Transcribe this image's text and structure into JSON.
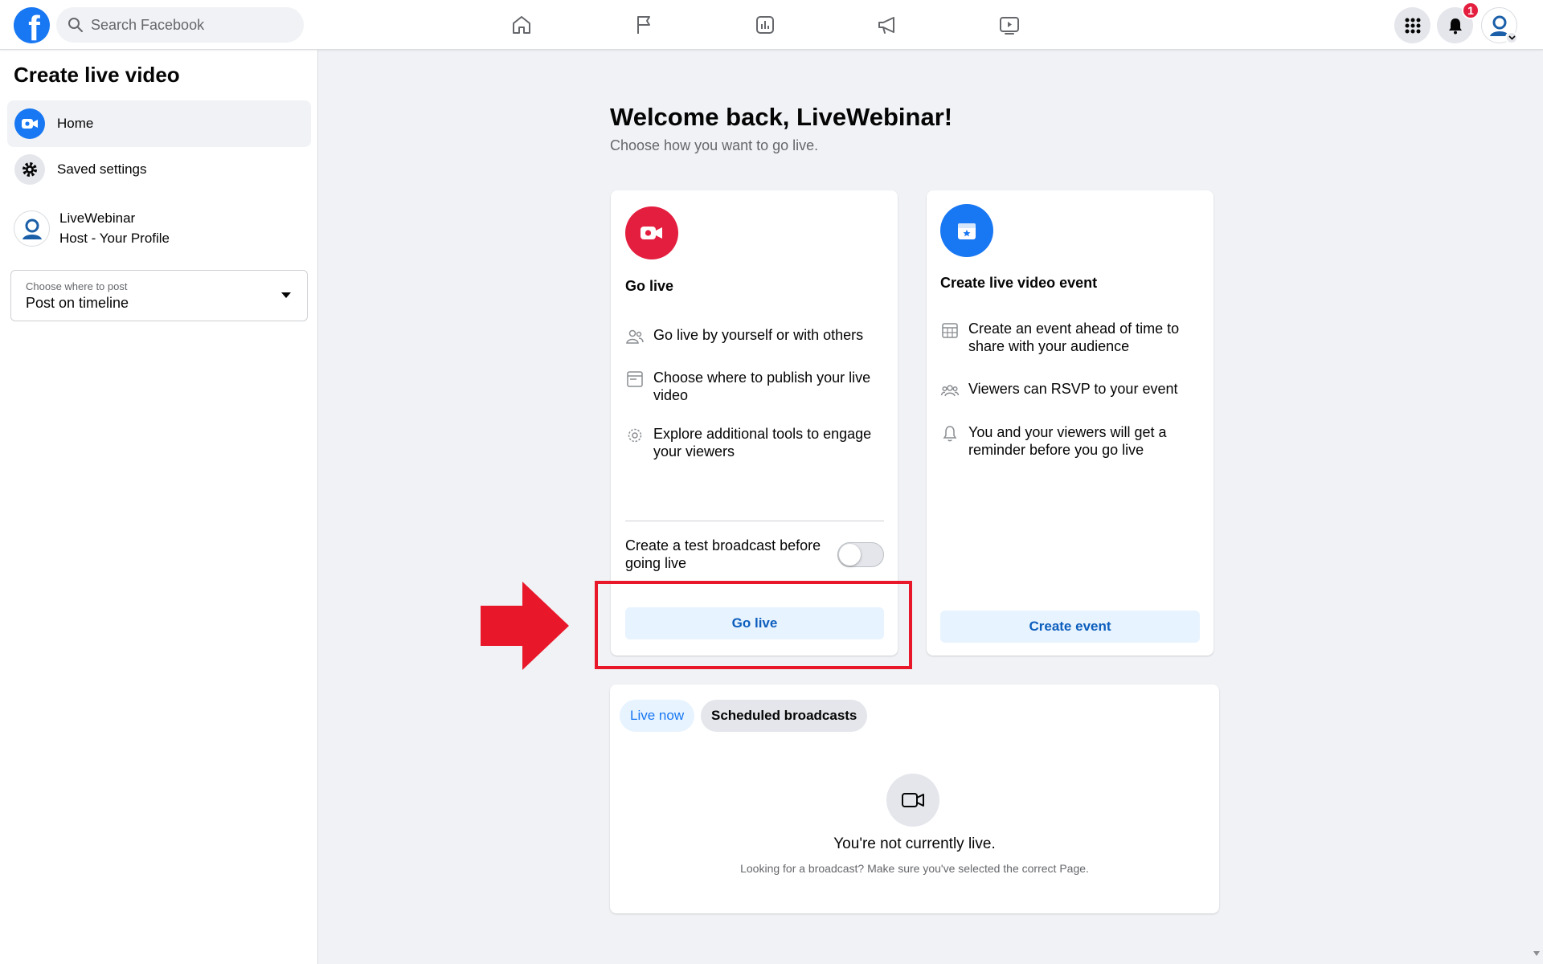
{
  "topbar": {
    "logo_letter": "f",
    "search_placeholder": "Search Facebook",
    "nav_icons": [
      "home-icon",
      "flag-icon",
      "insights-icon",
      "megaphone-icon",
      "video-icon"
    ],
    "notification_count": "1"
  },
  "sidebar": {
    "title": "Create live video",
    "items": [
      {
        "label": "Home",
        "icon": "live-video-icon",
        "active": true
      },
      {
        "label": "Saved settings",
        "icon": "gear-icon",
        "active": false
      }
    ],
    "profile": {
      "name": "LiveWebinar",
      "subtitle": "Host - Your Profile"
    },
    "post_select": {
      "label": "Choose where to post",
      "value": "Post on timeline"
    }
  },
  "main": {
    "welcome": "Welcome back, LiveWebinar!",
    "subtitle": "Choose how you want to go live.",
    "go_live_card": {
      "title": "Go live",
      "features": [
        "Go live by yourself or with others",
        "Choose where to publish your live video",
        "Explore additional tools to engage your viewers"
      ],
      "toggle_label": "Create a test broadcast before going live",
      "toggle_on": false,
      "button": "Go live"
    },
    "event_card": {
      "title": "Create live video event",
      "features": [
        "Create an event ahead of time to share with your audience",
        "Viewers can RSVP to your event",
        "You and your viewers will get a reminder before you go live"
      ],
      "button": "Create event"
    },
    "broadcasts": {
      "tabs": [
        "Live now",
        "Scheduled broadcasts"
      ],
      "active_tab": "Live now",
      "empty_title": "You're not currently live.",
      "empty_subtitle": "Looking for a broadcast? Make sure you've selected the correct Page."
    }
  },
  "colors": {
    "brand_blue": "#1877f2",
    "live_red": "#e41e3f",
    "highlight_red": "#e8182a",
    "button_light": "#e7f3ff"
  }
}
